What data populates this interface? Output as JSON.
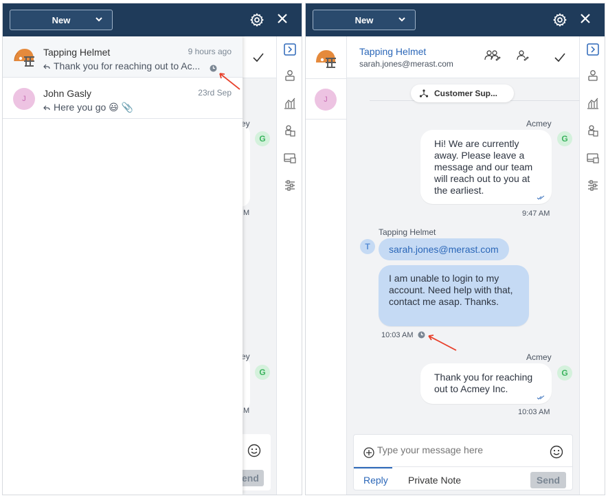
{
  "new_button": "New",
  "left": {
    "list": [
      {
        "name": "Tapping Helmet",
        "time": "9 hours ago",
        "message": "Thank you for reaching out to Ac..."
      },
      {
        "name": "John Gasly",
        "time": "23rd Sep",
        "message": "Here you go 😃 📎",
        "avatar": "J"
      }
    ],
    "bg_partial_texts": {
      "ts1": "M",
      "acmey1": "ey",
      "ts2": "M",
      "acmey2": "ey",
      "ts3": "M",
      "send": "end"
    },
    "g_avatar": "G"
  },
  "right": {
    "contact_name": "Tapping Helmet",
    "contact_email": "sarah.jones@merast.com",
    "inbox_pill": "Customer Sup...",
    "messages": [
      {
        "sender": "Acmey",
        "text": "Hi! We are currently away. Please leave a message and our team will reach out to you at the earliest.",
        "time": "9:47 AM",
        "avatar": "G"
      },
      {
        "sender": "Tapping Helmet",
        "email": "sarah.jones@merast.com",
        "text": "I am unable to login to my account. Need help with that, contact me asap. Thanks.",
        "time": "10:03 AM",
        "avatar": "T"
      },
      {
        "sender": "Acmey",
        "text": "Thank you for reaching out to Acmey Inc.",
        "time": "10:03 AM",
        "avatar": "G"
      }
    ],
    "composer": {
      "placeholder": "Type your message here",
      "tab_reply": "Reply",
      "tab_private": "Private Note",
      "send": "Send"
    }
  },
  "colors": {
    "topbar": "#1f3b5a",
    "accent": "#2b67b8",
    "bubble_in": "#c5daf4",
    "annotation_arrow": "#e8412c"
  }
}
